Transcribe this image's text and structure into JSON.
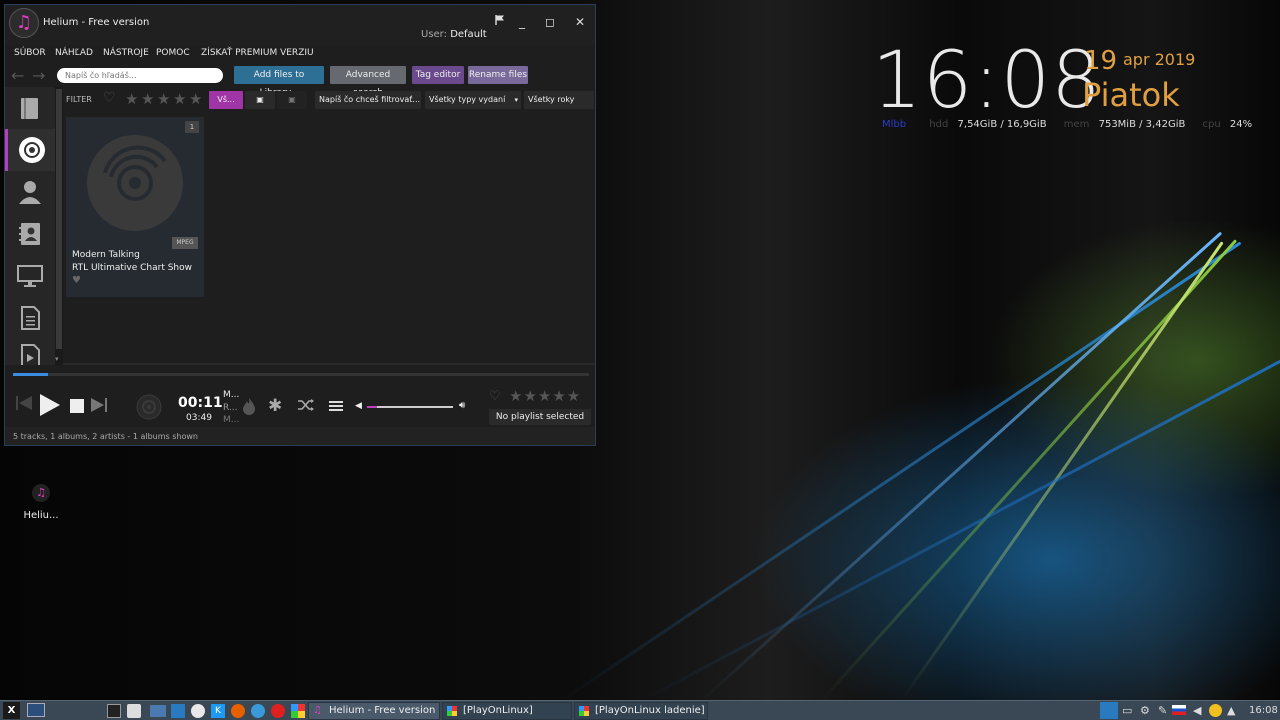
{
  "desktop": {
    "conky": {
      "time": "16:08",
      "day": "19",
      "month_year": "apr 2019",
      "weekday": "Piatok",
      "stats": [
        {
          "label": "Mlbb",
          "value": ""
        },
        {
          "label": "hdd",
          "value": "7,54GiB / 16,9GiB"
        },
        {
          "label": "mem",
          "value": "753MiB / 3,42GiB"
        },
        {
          "label": "cpu",
          "value": "24%"
        }
      ]
    },
    "icon": {
      "label": "Heliu..."
    }
  },
  "helium": {
    "title": "Helium - Free version",
    "user_label": "User:",
    "user_value": "Default",
    "menu": [
      "SÚBOR",
      "NÁHĽAD",
      "NÁSTROJE",
      "POMOC",
      "ZÍSKAŤ PREMIUM VERZIU"
    ],
    "search_placeholder": "Napíš čo hľadáš...",
    "toolbar_buttons": {
      "add_files": "Add files to Library...",
      "advanced_search": "Advanced search",
      "tag_editor": "Tag editor",
      "rename_files": "Rename files"
    },
    "filter": {
      "label": "FILTER",
      "all_button": "Vš...",
      "text_filter": "Napíš čo chceš filtrovať...",
      "release_types": "Všetky typy vydaní",
      "years": "Všetky roky"
    },
    "album": {
      "number": "1",
      "format": "MPEG",
      "artist": "Modern Talking",
      "title": "RTL Ultimative Chart Show"
    },
    "player": {
      "elapsed": "00:11",
      "total": "03:49",
      "track_lines": [
        "M...",
        "R...",
        "M..."
      ],
      "progress": 0.06,
      "volume": 0.12,
      "playlist_status": "No playlist selected"
    },
    "status": "5 tracks, 1 albums, 2 artists - 1 albums shown"
  },
  "taskbar": {
    "tasks": [
      {
        "label": "Helium - Free version",
        "active": true
      },
      {
        "label": "[PlayOnLinux]",
        "active": false
      },
      {
        "label": "[PlayOnLinux ladenie]",
        "active": false
      }
    ],
    "clock": "16:08"
  },
  "colors": {
    "accent": "#b040c0",
    "clock_orange": "#e0a040",
    "btn_blue": "#2e6f96",
    "btn_gray": "#666a70",
    "btn_purple": "#6a4a8c"
  }
}
